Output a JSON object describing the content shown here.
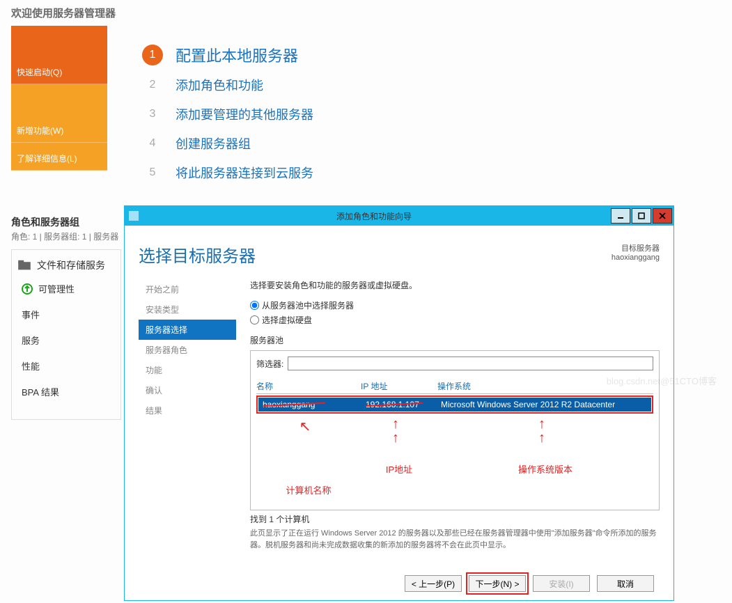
{
  "welcome": "欢迎使用服务器管理器",
  "tabs": {
    "quick": "快速启动(Q)",
    "addnew": "新增功能(W)",
    "more": "了解详细信息(L)"
  },
  "steps": [
    {
      "num": "1",
      "title": "配置此本地服务器"
    },
    {
      "num": "2",
      "title": "添加角色和功能"
    },
    {
      "num": "3",
      "title": "添加要管理的其他服务器"
    },
    {
      "num": "4",
      "title": "创建服务器组"
    },
    {
      "num": "5",
      "title": "将此服务器连接到云服务"
    }
  ],
  "roles": {
    "heading": "角色和服务器组",
    "sub": "角色: 1 | 服务器组: 1 | 服务器"
  },
  "filePanel": {
    "header": "文件和存储服务",
    "rows": [
      "可管理性",
      "事件",
      "服务",
      "性能",
      "BPA 结果"
    ]
  },
  "dialog": {
    "windowTitle": "添加角色和功能向导",
    "heading": "选择目标服务器",
    "destLabel": "目标服务器",
    "destServer": "haoxianggang",
    "nav": [
      "开始之前",
      "安装类型",
      "服务器选择",
      "服务器角色",
      "功能",
      "确认",
      "结果"
    ],
    "navActiveIndex": 2,
    "instruction": "选择要安装角色和功能的服务器或虚拟硬盘。",
    "radio1": "从服务器池中选择服务器",
    "radio2": "选择虚拟硬盘",
    "poolLabel": "服务器池",
    "filterLabel": "筛选器:",
    "filterValue": "",
    "columns": {
      "name": "名称",
      "ip": "IP 地址",
      "os": "操作系统"
    },
    "row": {
      "name": "haoxianggang",
      "ip": "192.168.1.107",
      "os": "Microsoft Windows Server 2012 R2 Datacenter"
    },
    "annotations": {
      "name": "计算机名称",
      "ip": "IP地址",
      "os": "操作系统版本"
    },
    "found": "找到 1 个计算机",
    "desc": "此页显示了正在运行 Windows Server 2012 的服务器以及那些已经在服务器管理器中使用\"添加服务器\"命令所添加的服务器。脱机服务器和尚未完成数据收集的新添加的服务器将不会在此页中显示。",
    "buttons": {
      "prev": "< 上一步(P)",
      "next": "下一步(N) >",
      "install": "安装(I)",
      "cancel": "取消"
    }
  },
  "watermark": "blog.csdn.net@51CTO博客"
}
